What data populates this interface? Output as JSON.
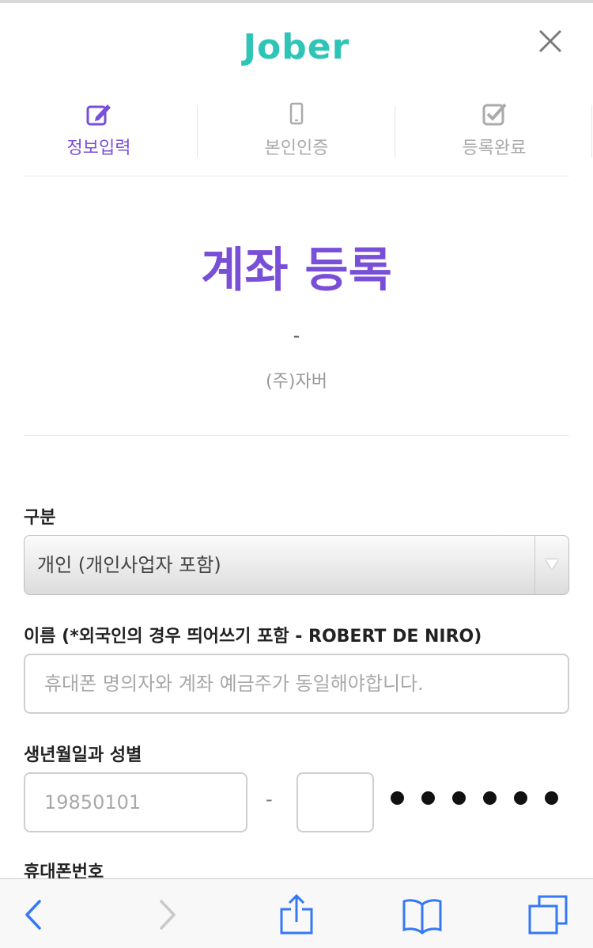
{
  "header": {
    "logo_text": "Jober",
    "close_icon": "close-icon",
    "logo_color": "#2ec4b6"
  },
  "steps": [
    {
      "label": "정보입력",
      "icon": "edit-icon",
      "active": true
    },
    {
      "label": "본인인증",
      "icon": "phone-icon",
      "active": false
    },
    {
      "label": "등록완료",
      "icon": "checkbox-icon",
      "active": false
    }
  ],
  "hero": {
    "title": "계좌 등록",
    "dash": "-",
    "company": "(주)자버"
  },
  "form": {
    "type_label": "구분",
    "type_value": "개인 (개인사업자 포함)",
    "name_label": "이름 (*외국인의 경우 띄어쓰기 포함 - ROBERT DE NIRO)",
    "name_placeholder": "휴대폰 명의자와 계좌 예금주가 동일해야합니다.",
    "birth_label": "생년월일과 성별",
    "birth_placeholder": "19850101",
    "birth_separator": "-",
    "gender_value": "",
    "masked_digits": 6,
    "phone_label": "휴대폰번호"
  },
  "toolbar": {
    "back_icon": "back-chevron-icon",
    "forward_icon": "forward-chevron-icon",
    "share_icon": "share-icon",
    "bookmarks_icon": "bookmarks-icon",
    "tabs_icon": "tabs-icon"
  },
  "colors": {
    "accent": "#7a4fd8",
    "ios_blue": "#3478f6"
  }
}
